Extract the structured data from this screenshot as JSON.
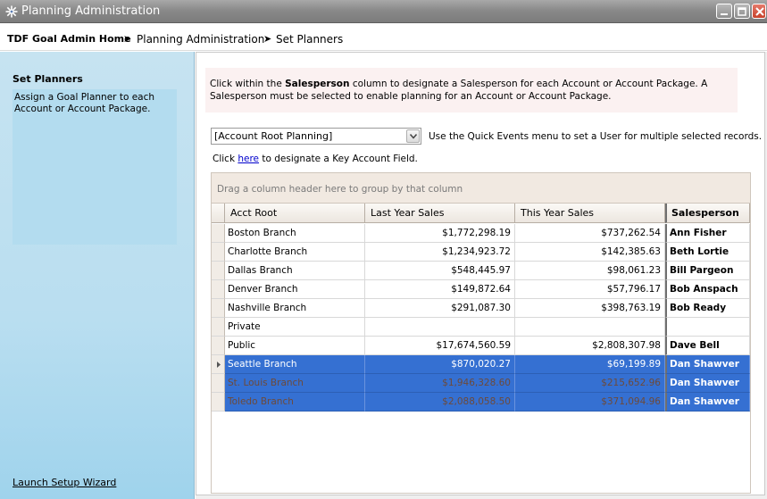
{
  "window": {
    "title": "Planning Administration"
  },
  "breadcrumb": {
    "home": "TDF Goal Admin Home",
    "items": [
      "Planning Administration",
      "Set Planners"
    ],
    "separator": "➤"
  },
  "left_panel": {
    "title": "Set Planners",
    "description": "Assign a Goal Planner to each Account or Account Package.",
    "wizard_link": "Launch Setup Wizard"
  },
  "main": {
    "info_prefix": "Click within the ",
    "info_bold": "Salesperson",
    "info_suffix": " column to designate a Salesperson for each Account or Account Package.  A Salesperson must be selected to enable planning for an Account or Account Package.",
    "combo_value": "[Account Root Planning]",
    "quick_events_text": "Use the Quick Events menu to set a User for multiple selected records.",
    "key_prefix": "Click ",
    "key_link": "here",
    "key_suffix": " to designate a Key Account Field."
  },
  "grid": {
    "group_hint": "Drag a column header here to group by that column",
    "columns": [
      "Acct Root",
      "Last Year Sales",
      "This Year Sales",
      "Salesperson"
    ],
    "rows": [
      {
        "root": "Boston Branch",
        "last": "$1,772,298.19",
        "this": "$737,262.54",
        "sp": "Ann Fisher"
      },
      {
        "root": "Charlotte Branch",
        "last": "$1,234,923.72",
        "this": "$142,385.63",
        "sp": "Beth Lortie"
      },
      {
        "root": "Dallas Branch",
        "last": "$548,445.97",
        "this": "$98,061.23",
        "sp": "Bill Pargeon"
      },
      {
        "root": "Denver Branch",
        "last": "$149,872.64",
        "this": "$57,796.17",
        "sp": "Bob Anspach"
      },
      {
        "root": "Nashville Branch",
        "last": "$291,087.30",
        "this": "$398,763.19",
        "sp": "Bob Ready"
      },
      {
        "root": "Private",
        "last": "",
        "this": "",
        "sp": ""
      },
      {
        "root": "Public",
        "last": "$17,674,560.59",
        "this": "$2,808,307.98",
        "sp": "Dave Bell"
      },
      {
        "root": "Seattle Branch",
        "last": "$870,020.27",
        "this": "$69,199.89",
        "sp": "Dan Shawver"
      },
      {
        "root": "St. Louis Branch",
        "last": "$1,946,328.60",
        "this": "$215,652.96",
        "sp": "Dan Shawver"
      },
      {
        "root": "Toledo Branch",
        "last": "$2,088,058.50",
        "this": "$371,094.96",
        "sp": "Dan Shawver"
      }
    ]
  },
  "colors": {
    "selection": "#3570d2",
    "titlebar": "#8a8a8a",
    "left_panel": "#b9def0"
  }
}
